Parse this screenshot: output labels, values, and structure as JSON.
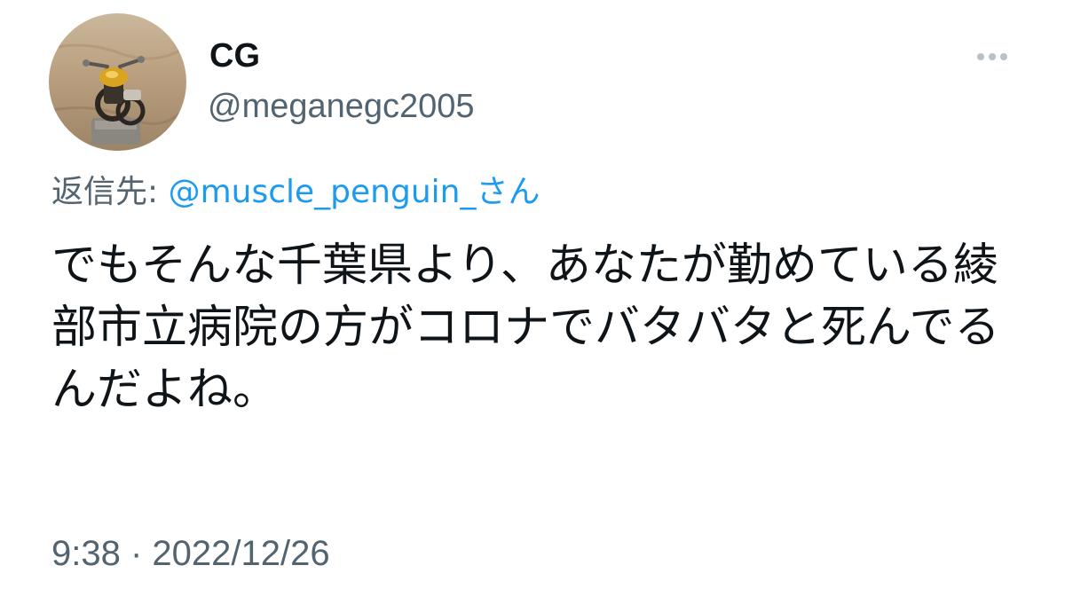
{
  "tweet": {
    "display_name": "CG",
    "handle": "@meganegc2005",
    "reply_prefix": "返信先: ",
    "reply_to": "@muscle_penguin_さん",
    "text": "でもそんな千葉県より、あなたが勤めている綾部市立病院の方がコロナでバタバタと死んでるんだよね。",
    "time": "9:38",
    "separator": " · ",
    "date": "2022/12/26"
  },
  "icons": {
    "more": "more-horizontal-icon",
    "avatar": "avatar-motorcycle-image"
  },
  "colors": {
    "text": "#0f1419",
    "secondary": "#536471",
    "link": "#1d9bf0",
    "background": "#ffffff"
  }
}
